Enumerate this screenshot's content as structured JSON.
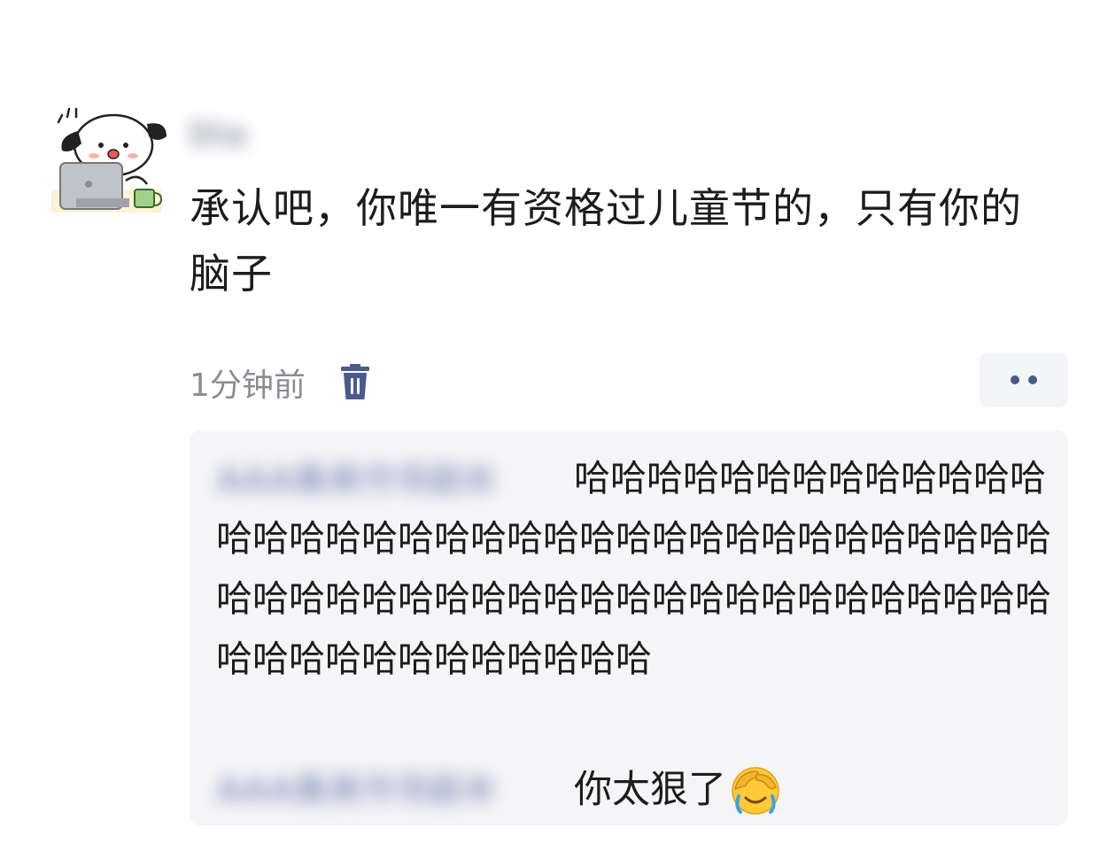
{
  "comment": {
    "username": "Sta",
    "text": "承认吧，你唯一有资格过儿童节的，只有你的脑子",
    "timestamp": "1分钟前",
    "icons": [
      "avatar-dog-laptop",
      "trash-icon",
      "more-dots-icon"
    ]
  },
  "replies": [
    {
      "name": "AAA集美市场副本",
      "text": "哈哈哈哈哈哈哈哈哈哈哈哈哈哈哈哈哈哈哈哈哈哈哈哈哈哈哈哈哈哈哈哈哈哈哈哈哈哈哈哈哈哈哈哈哈哈哈哈哈哈哈哈哈哈哈哈哈哈哈哈哈哈哈哈哈哈哈哈哈哈哈"
    },
    {
      "name": "AAA集美市场副本",
      "text": "你太狠了",
      "emoji": "face-palm-crying-emoji"
    }
  ],
  "colors": {
    "accent": "#4a5a8c",
    "timestamp": "#8a8d93",
    "reply_background": "#f5f5f7"
  }
}
